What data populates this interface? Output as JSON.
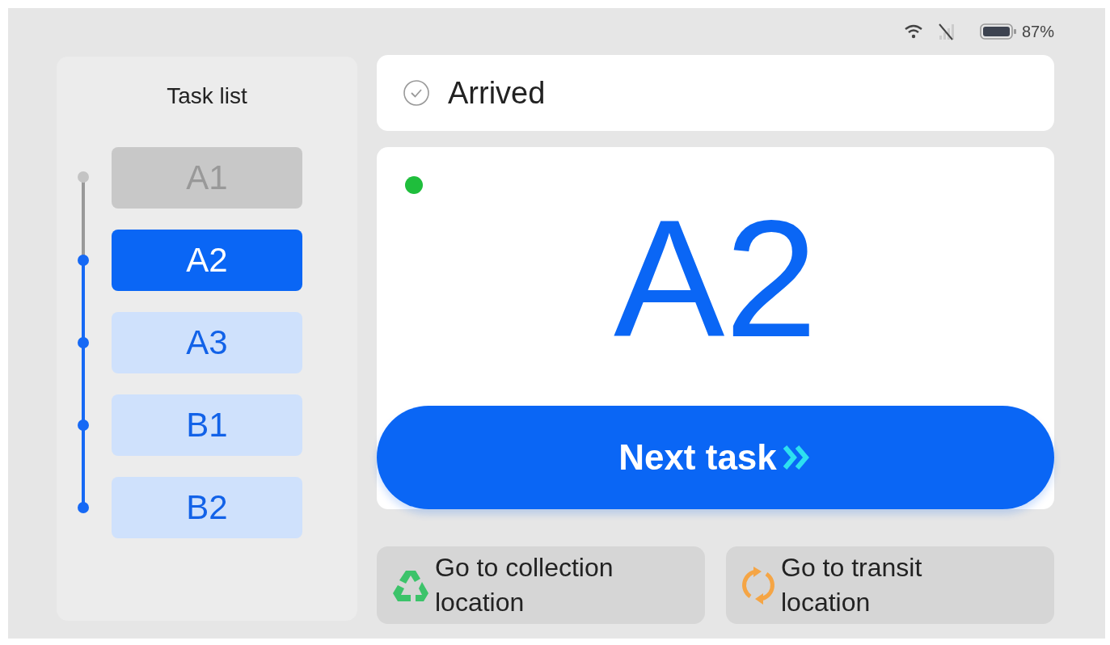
{
  "status_bar": {
    "wifi": true,
    "cellular_signal": false,
    "battery_text": "87%"
  },
  "task_list": {
    "title": "Task list",
    "tasks": [
      {
        "label": "A1",
        "completed": true,
        "selected": false
      },
      {
        "label": "A2",
        "completed": false,
        "selected": true
      },
      {
        "label": "A3",
        "completed": false,
        "selected": false
      },
      {
        "label": "B1",
        "completed": false,
        "selected": false
      },
      {
        "label": "B2",
        "completed": false,
        "selected": false
      }
    ]
  },
  "arrival": {
    "text": "Arrived"
  },
  "current_task": {
    "connected": true,
    "label": "A2"
  },
  "next_button": {
    "label": "Next task"
  },
  "actions": [
    {
      "kind": "collection",
      "label": "Go to collection location"
    },
    {
      "kind": "transit",
      "label": "Go to transit location"
    }
  ]
}
